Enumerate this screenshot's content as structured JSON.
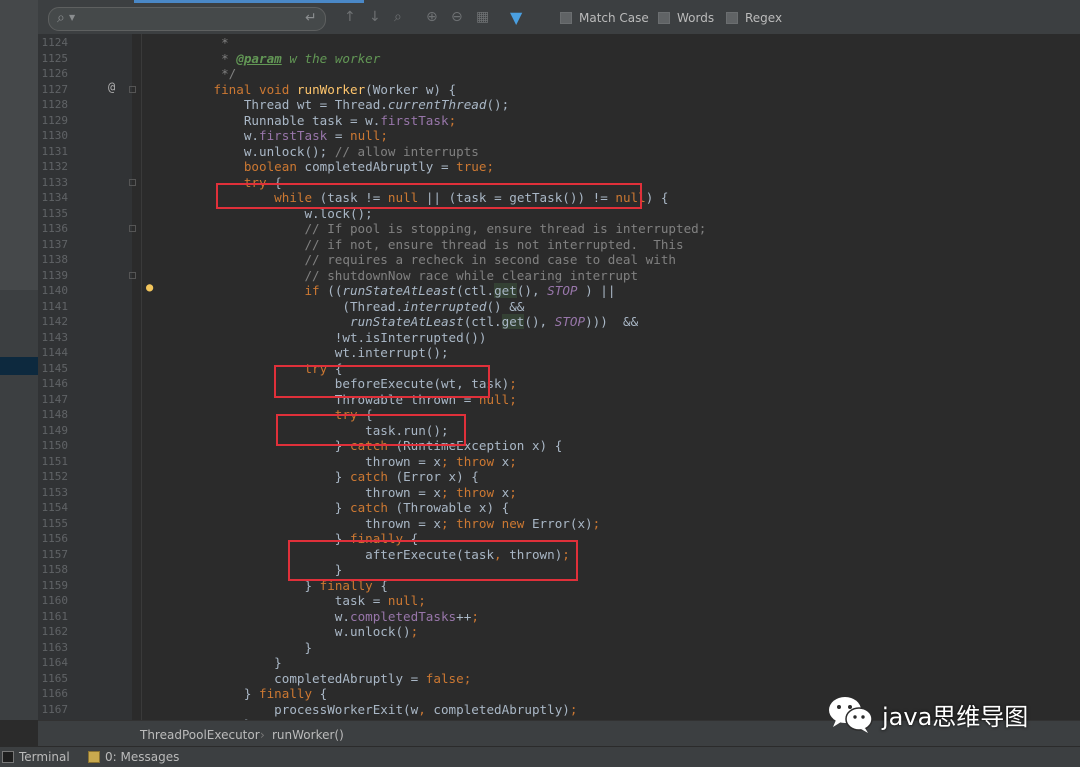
{
  "find_bar": {
    "search_value": "",
    "options": {
      "match_case": "Match Case",
      "words": "Words",
      "regex": "Regex"
    }
  },
  "code_lines": [
    {
      "num": "1124",
      "tokens": [
        [
          "cmt",
          "       *"
        ]
      ]
    },
    {
      "num": "1125",
      "tokens": [
        [
          "cmt",
          "       * "
        ],
        [
          "doctag",
          "@param"
        ],
        [
          "doc",
          " w the worker"
        ]
      ]
    },
    {
      "num": "1126",
      "tokens": [
        [
          "cmt",
          "       */"
        ]
      ]
    },
    {
      "num": "1127",
      "tokens": [
        [
          "kw",
          "      final void "
        ],
        [
          "fn",
          "runWorker"
        ],
        [
          "",
          "(Worker w) {"
        ]
      ]
    },
    {
      "num": "1128",
      "tokens": [
        [
          "",
          "          Thread wt = Thread."
        ],
        [
          "it",
          "currentThread"
        ],
        [
          "",
          "();"
        ]
      ]
    },
    {
      "num": "1129",
      "tokens": [
        [
          "",
          "          Runnable task = w."
        ],
        [
          "fld",
          "firstTask"
        ],
        [
          "kw",
          ";"
        ]
      ]
    },
    {
      "num": "1130",
      "tokens": [
        [
          "",
          "          w."
        ],
        [
          "fld",
          "firstTask"
        ],
        [
          "",
          ""
        ],
        [
          "",
          ""
        ],
        [
          "",
          " = "
        ],
        [
          "kw",
          "null;"
        ]
      ]
    },
    {
      "num": "1131",
      "tokens": [
        [
          "",
          "          w.unlock(); "
        ],
        [
          "cmt",
          "// allow interrupts"
        ]
      ]
    },
    {
      "num": "1132",
      "tokens": [
        [
          "kw",
          "          boolean "
        ],
        [
          "",
          "completedAbruptly = "
        ],
        [
          "kw",
          "true;"
        ]
      ]
    },
    {
      "num": "1133",
      "tokens": [
        [
          "kw",
          "          try "
        ],
        [
          "",
          "{"
        ]
      ]
    },
    {
      "num": "1134",
      "tokens": [
        [
          "kw",
          "              while "
        ],
        [
          "",
          "(task != "
        ],
        [
          "kw",
          "null "
        ],
        [
          "",
          "|| (task = getTask()) != "
        ],
        [
          "kw",
          "null"
        ],
        [
          "",
          ") {"
        ]
      ]
    },
    {
      "num": "1135",
      "tokens": [
        [
          "",
          "                  w.lock();"
        ]
      ]
    },
    {
      "num": "1136",
      "tokens": [
        [
          "cmt",
          "                  // If pool is stopping, ensure thread is interrupted;"
        ]
      ]
    },
    {
      "num": "1137",
      "tokens": [
        [
          "cmt",
          "                  // if not, ensure thread is not interrupted.  This"
        ]
      ]
    },
    {
      "num": "1138",
      "tokens": [
        [
          "cmt",
          "                  // requires a recheck in second case to deal with"
        ]
      ]
    },
    {
      "num": "1139",
      "tokens": [
        [
          "cmt",
          "                  // shutdownNow race while clearing interrupt"
        ]
      ]
    },
    {
      "num": "1140",
      "tokens": [
        [
          "kw",
          "                  if "
        ],
        [
          "",
          "(("
        ],
        [
          "it",
          "runStateAtLeast"
        ],
        [
          "",
          "(ctl."
        ],
        [
          "get",
          "get"
        ],
        [
          "",
          "(), "
        ],
        [
          "cnst",
          "STOP"
        ],
        [
          "",
          " ) ||"
        ]
      ]
    },
    {
      "num": "1141",
      "tokens": [
        [
          "",
          "                       (Thread."
        ],
        [
          "it",
          "interrupted"
        ],
        [
          "",
          "() &&"
        ]
      ]
    },
    {
      "num": "1142",
      "tokens": [
        [
          "",
          "                        "
        ],
        [
          "it",
          "runStateAtLeast"
        ],
        [
          "",
          "(ctl."
        ],
        [
          "get",
          "get"
        ],
        [
          "",
          "(), "
        ],
        [
          "cnst",
          "STOP"
        ],
        [
          "",
          ")))  &&"
        ]
      ]
    },
    {
      "num": "1143",
      "tokens": [
        [
          "",
          "                      !wt.isInterrupted())"
        ]
      ]
    },
    {
      "num": "1144",
      "tokens": [
        [
          "",
          "                      wt.interrupt();"
        ]
      ]
    },
    {
      "num": "1145",
      "tokens": [
        [
          "kw",
          "                  try "
        ],
        [
          "",
          "{"
        ]
      ]
    },
    {
      "num": "1146",
      "tokens": [
        [
          "",
          "                      beforeExecute(wt, task)"
        ],
        [
          "kw",
          ";"
        ]
      ]
    },
    {
      "num": "1147",
      "tokens": [
        [
          "",
          "                      Throwable thrown = "
        ],
        [
          "kw",
          "null;"
        ]
      ]
    },
    {
      "num": "1148",
      "tokens": [
        [
          "kw",
          "                      try "
        ],
        [
          "",
          "{"
        ]
      ]
    },
    {
      "num": "1149",
      "tokens": [
        [
          "",
          "                          task.run();"
        ]
      ]
    },
    {
      "num": "1150",
      "tokens": [
        [
          "",
          "                      } "
        ],
        [
          "kw",
          "catch "
        ],
        [
          "",
          "(RuntimeException x) {"
        ]
      ]
    },
    {
      "num": "1151",
      "tokens": [
        [
          "",
          "                          thrown = x"
        ],
        [
          "kw",
          "; throw "
        ],
        [
          "",
          "x"
        ],
        [
          "kw",
          ";"
        ]
      ]
    },
    {
      "num": "1152",
      "tokens": [
        [
          "",
          "                      } "
        ],
        [
          "kw",
          "catch "
        ],
        [
          "",
          "(Error x) {"
        ]
      ]
    },
    {
      "num": "1153",
      "tokens": [
        [
          "",
          "                          thrown = x"
        ],
        [
          "kw",
          "; throw "
        ],
        [
          "",
          "x"
        ],
        [
          "kw",
          ";"
        ]
      ]
    },
    {
      "num": "1154",
      "tokens": [
        [
          "",
          "                      } "
        ],
        [
          "kw",
          "catch "
        ],
        [
          "",
          "(Throwable x) {"
        ]
      ]
    },
    {
      "num": "1155",
      "tokens": [
        [
          "",
          "                          thrown = x"
        ],
        [
          "kw",
          "; throw new "
        ],
        [
          "",
          "Error(x)"
        ],
        [
          "kw",
          ";"
        ]
      ]
    },
    {
      "num": "1156",
      "tokens": [
        [
          "",
          "                      } "
        ],
        [
          "kw",
          "finally "
        ],
        [
          "",
          "{"
        ]
      ]
    },
    {
      "num": "1157",
      "tokens": [
        [
          "",
          "                          afterExecute(task"
        ],
        [
          "kw",
          ", "
        ],
        [
          "",
          "thrown)"
        ],
        [
          "kw",
          ";"
        ]
      ]
    },
    {
      "num": "1158",
      "tokens": [
        [
          "",
          "                      }"
        ]
      ]
    },
    {
      "num": "1159",
      "tokens": [
        [
          "",
          "                  } "
        ],
        [
          "kw",
          "finally "
        ],
        [
          "",
          "{"
        ]
      ]
    },
    {
      "num": "1160",
      "tokens": [
        [
          "",
          "                      task = "
        ],
        [
          "kw",
          "null;"
        ]
      ]
    },
    {
      "num": "1161",
      "tokens": [
        [
          "",
          "                      w."
        ],
        [
          "fld",
          "completedTasks"
        ],
        [
          "",
          "++"
        ],
        [
          "kw",
          ";"
        ]
      ]
    },
    {
      "num": "1162",
      "tokens": [
        [
          "",
          "                      w.unlock()"
        ],
        [
          "kw",
          ";"
        ]
      ]
    },
    {
      "num": "1163",
      "tokens": [
        [
          "",
          "                  }"
        ]
      ]
    },
    {
      "num": "1164",
      "tokens": [
        [
          "",
          "              }"
        ]
      ]
    },
    {
      "num": "1165",
      "tokens": [
        [
          "",
          "              completedAbruptly = "
        ],
        [
          "kw",
          "false;"
        ]
      ]
    },
    {
      "num": "1166",
      "tokens": [
        [
          "",
          "          } "
        ],
        [
          "kw",
          "finally "
        ],
        [
          "",
          "{"
        ]
      ]
    },
    {
      "num": "1167",
      "tokens": [
        [
          "",
          "              processWorkerExit(w"
        ],
        [
          "kw",
          ", "
        ],
        [
          "",
          "completedAbruptly)"
        ],
        [
          "kw",
          ";"
        ]
      ]
    },
    {
      "num": "1168",
      "tokens": [
        [
          "",
          "          }"
        ]
      ]
    }
  ],
  "breadcrumb": {
    "class": "ThreadPoolExecutor",
    "method": "runWorker()"
  },
  "bottom_bar": {
    "terminal": "Terminal",
    "messages": "0: Messages"
  },
  "watermark": "java思维导图",
  "colors": {
    "highlight_box": "#e0303a",
    "keyword": "#cc7832",
    "method": "#ffc66d",
    "field": "#9876aa",
    "comment": "#808080"
  }
}
